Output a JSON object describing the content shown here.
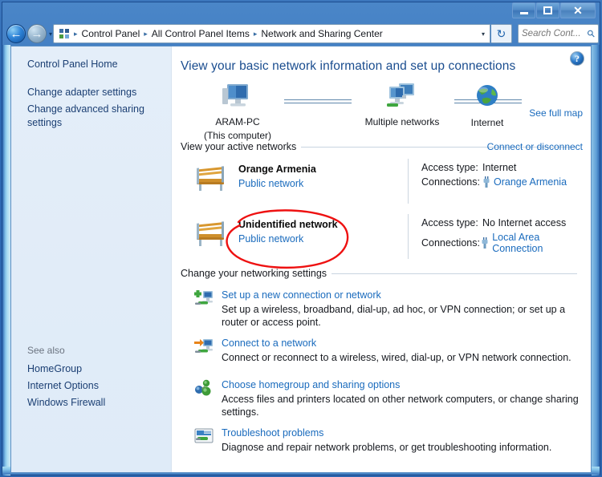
{
  "window": {
    "minimize_label": "Minimize",
    "maximize_label": "Maximize",
    "close_label": "Close"
  },
  "navbar": {
    "back_glyph": "←",
    "forward_glyph": "→",
    "history_glyph": "▾",
    "breadcrumbs": [
      "Control Panel",
      "All Control Panel Items",
      "Network and Sharing Center"
    ],
    "separator": "▸",
    "dropdown_glyph": "▾",
    "refresh_glyph": "↻",
    "search_placeholder": "Search Cont...",
    "search_value": "",
    "search_icon": "⚲"
  },
  "sidebar": {
    "items": [
      {
        "label": "Control Panel Home"
      },
      {
        "label": "Change adapter settings"
      },
      {
        "label": "Change advanced sharing settings"
      }
    ],
    "see_also_title": "See also",
    "see_also": [
      {
        "label": "HomeGroup"
      },
      {
        "label": "Internet Options"
      },
      {
        "label": "Windows Firewall"
      }
    ]
  },
  "content": {
    "help_glyph": "?",
    "page_title": "View your basic network information and set up connections",
    "map": {
      "see_full_map": "See full map",
      "nodes": [
        {
          "label": "ARAM-PC",
          "sublabel": "(This computer)",
          "icon": "computer-icon"
        },
        {
          "label": "Multiple networks",
          "sublabel": "",
          "icon": "multiple-networks-icon"
        },
        {
          "label": "Internet",
          "sublabel": "",
          "icon": "globe-icon"
        }
      ]
    },
    "active_networks": {
      "heading": "View your active networks",
      "action": "Connect or disconnect",
      "access_type_label": "Access type:",
      "connections_label": "Connections:",
      "rows": [
        {
          "name": "Orange Armenia",
          "type": "Public network",
          "access_type": "Internet",
          "connection": "Orange Armenia",
          "annotated": false
        },
        {
          "name": "Unidentified network",
          "type": "Public network",
          "access_type": "No Internet access",
          "connection": "Local Area Connection",
          "annotated": true
        }
      ]
    },
    "networking_settings": {
      "heading": "Change your networking settings",
      "items": [
        {
          "link": "Set up a new connection or network",
          "desc": "Set up a wireless, broadband, dial-up, ad hoc, or VPN connection; or set up a router or access point.",
          "icon": "new-connection-icon"
        },
        {
          "link": "Connect to a network",
          "desc": "Connect or reconnect to a wireless, wired, dial-up, or VPN network connection.",
          "icon": "connect-network-icon"
        },
        {
          "link": "Choose homegroup and sharing options",
          "desc": "Access files and printers located on other network computers, or change sharing settings.",
          "icon": "homegroup-icon"
        },
        {
          "link": "Troubleshoot problems",
          "desc": "Diagnose and repair network problems, or get troubleshooting information.",
          "icon": "troubleshoot-icon"
        }
      ]
    }
  },
  "colors": {
    "link": "#1a6bbd",
    "title": "#1a4d8f",
    "annotation": "#ee1111",
    "frame": "#2f6ab4"
  }
}
